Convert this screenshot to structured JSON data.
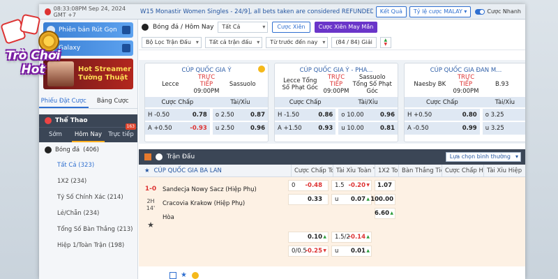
{
  "topbar": {
    "datetime": "08:33:08PM Sep 24, 2024 GMT +7",
    "ticker": "W15 Monastir Women Singles - 24/9], all bets taken are considered REFUNDED (Except those",
    "results_btn": "Kết Quả",
    "odds_format": "Tỷ lệ cược MALAY",
    "quick_bet": "Cược Nhanh"
  },
  "logo": {
    "line1": "Trò Chơi",
    "line2": "Hot"
  },
  "sidebar": {
    "promo1": "Phiên bản Rút Gọn",
    "promo2": "Galaxy",
    "streamer_line1": "Hot Streamer",
    "streamer_line2": "Tường Thuật",
    "tabs": [
      "Phiếu Đặt Cược",
      "Bảng Cược"
    ],
    "sport_header": "Thể Thao",
    "time_tabs": [
      "Sớm",
      "Hôm Nay",
      "Trực tiếp"
    ],
    "live_count": "163",
    "sport": "Bóng đá",
    "sport_count": "(406)",
    "markets": [
      {
        "label": "Tất Cả (323)"
      },
      {
        "label": "1X2 (234)"
      },
      {
        "label": "Tỷ Số Chính Xác (214)"
      },
      {
        "label": "Lẻ/Chẵn (234)"
      },
      {
        "label": "Tổng Số Bàn Thắng (213)"
      },
      {
        "label": "Hiệp 1/Toàn Trận (198)"
      }
    ]
  },
  "filters": {
    "title": "Bóng đá / Hôm Nay",
    "all": "Tất Cả",
    "parlay": "Cược Xiên",
    "lucky_parlay": "Cược Xiên May Mắn",
    "league_filter": "Bộ Lọc Trận Đấu",
    "all_matches": "Tất cả trận đấu",
    "sort": "Từ trước đến nay",
    "count": "(84 / 84) Giải"
  },
  "cards": [
    {
      "league": "CÚP QUỐC GIA Ý",
      "home": "Lecce",
      "away": "Sassuolo",
      "status": "TRỰC TIẾP",
      "time": "09:00PM",
      "hcap_header": "Cược Chấp",
      "ou_header": "Tài/Xỉu",
      "rows": [
        {
          "h_lbl": "H -0.50",
          "h_val": "0.78",
          "h_neg": false,
          "ou_lbl": "o 2.50",
          "ou_val": "0.87",
          "ou_neg": false
        },
        {
          "h_lbl": "A +0.50",
          "h_val": "-0.93",
          "h_neg": true,
          "ou_lbl": "u 2.50",
          "ou_val": "0.96",
          "ou_neg": false
        }
      ]
    },
    {
      "league": "CÚP QUỐC GIA Ý - PHA...",
      "home": "Lecce Tổng Số Phạt Góc",
      "away": "Sassuolo Tổng Số Phạt Góc",
      "status": "TRỰC TIẾP",
      "time": "09:00PM",
      "hcap_header": "Cược Chấp",
      "ou_header": "Tài/Xỉu",
      "rows": [
        {
          "h_lbl": "H -1.50",
          "h_val": "0.86",
          "h_neg": false,
          "ou_lbl": "o 10.00",
          "ou_val": "0.96",
          "ou_neg": false
        },
        {
          "h_lbl": "A +1.50",
          "h_val": "0.93",
          "h_neg": false,
          "ou_lbl": "u 10.00",
          "ou_val": "0.81",
          "ou_neg": false
        }
      ]
    },
    {
      "league": "CÚP QUỐC GIA ĐAN M...",
      "home": "Naesby BK",
      "away": "B.93",
      "status": "TRỰC TIẾP",
      "time": "09:00PM",
      "hcap_header": "Cược Chấp",
      "ou_header": "Tài/Xỉu",
      "rows": [
        {
          "h_lbl": "H +0.50",
          "h_val": "0.80",
          "h_neg": false,
          "ou_lbl": "o 3.25",
          "ou_val": "",
          "ou_neg": false
        },
        {
          "h_lbl": "A -0.50",
          "h_val": "0.99",
          "h_neg": false,
          "ou_lbl": "u 3.25",
          "ou_val": "",
          "ou_neg": false
        }
      ]
    }
  ],
  "section": {
    "title": "Trận Đấu",
    "sort_select": "Lựa chọn bình thường",
    "league": "CÚP QUỐC GIA BA LAN",
    "columns": [
      "Cược Chấp Toà...",
      "Tài Xỉu Toàn Trận",
      "1X2 To...",
      "Bàn Thắng Tiếp...",
      "Cược Chấp Hiệ...",
      "Tài Xỉu Hiệp"
    ]
  },
  "match": {
    "score": "1-0",
    "period": "2H",
    "minute": "14'",
    "home": "Sandecja Nowy Sacz (Hiệp Phụ)",
    "away": "Cracovia Krakow (Hiệp Phụ)",
    "draw": "Hòa",
    "odds": {
      "hcap1_h": "0",
      "hcap1_v": "-0.48",
      "hcap2_v": "0.33",
      "ou1_h": "1.5",
      "ou1_v": "-0.20",
      "ou2_h": "u",
      "ou2_v": "0.07",
      "x1": "1.07",
      "x2": "100.00",
      "xd": "6.60",
      "hcap3_v": "0.10",
      "hcap4_h": "0/0.5",
      "hcap4_v": "-0.25",
      "ou3_h": "1.5/2",
      "ou3_v": "-0.14",
      "ou4_h": "u",
      "ou4_v": "0.01"
    }
  }
}
